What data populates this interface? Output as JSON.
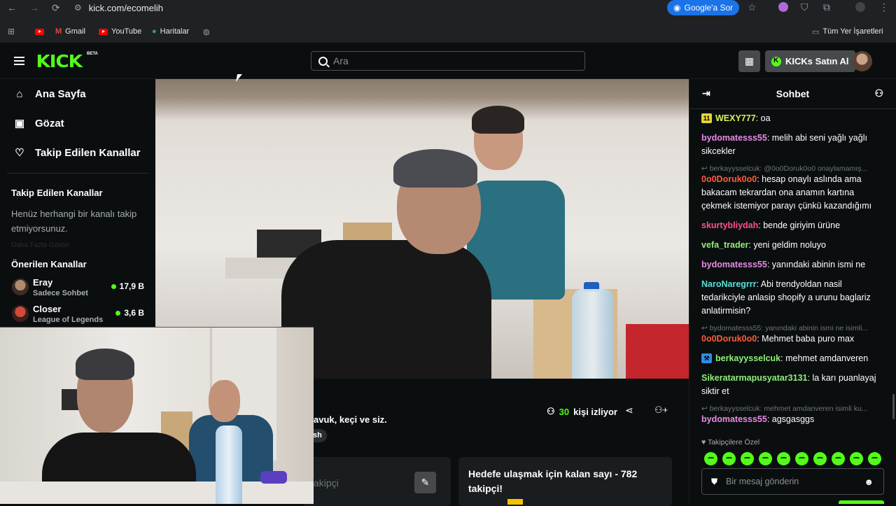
{
  "browser": {
    "url": "kick.com/ecomelih",
    "google_btn": "Google'a Sor",
    "bookmarks": [
      "Gmail",
      "YouTube",
      "Haritalar"
    ],
    "all_bookmarks": "Tüm Yer İşaretleri"
  },
  "header": {
    "logo": "KICK",
    "beta": "BETA",
    "search_placeholder": "Ara",
    "kicks_btn": "KICKs Satın Al"
  },
  "sidebar": {
    "nav": [
      {
        "label": "Ana Sayfa",
        "icon": "home-icon"
      },
      {
        "label": "Gözat",
        "icon": "browse-icon"
      },
      {
        "label": "Takip Edilen Kanallar",
        "icon": "heart-icon"
      }
    ],
    "followed_title": "Takip Edilen Kanallar",
    "followed_empty": "Henüz herhangi bir kanalı takip etmiyorsunuz.",
    "faded_text": "Daha Fazla Göster",
    "recommended_title": "Önerilen Kanallar",
    "channels": [
      {
        "name": "Eray",
        "category": "Sadece Sohbet",
        "viewers": "17,9 B"
      },
      {
        "name": "Closer",
        "category": "League of Legends",
        "viewers": "3,6 B"
      }
    ]
  },
  "stream": {
    "description": "avuk, keçi ve siz.",
    "tag": "sh",
    "viewers_count": "30",
    "viewers_label": "kişi izliyor",
    "goal_placeholder": "akipçi",
    "goal_text": "Hedefe ulaşmak için kalan sayı - 782 takipçi!"
  },
  "chat": {
    "title": "Sohbet",
    "messages": [
      {
        "badge": "11",
        "badge_color": "#e6d33a",
        "user": "WEXY777",
        "color": "#d8f15a",
        "text": "oa"
      },
      {
        "user": "bydomatesss55",
        "color": "#e88ae6",
        "text": "melih abi seni yağlı yağlı sikcekler"
      },
      {
        "reply": "berkayysselcuk: @0o0Doruk0o0 onaylamamış..."
      },
      {
        "user": "0o0Doruk0o0",
        "color": "#ff5a3c",
        "text": "hesap onaylı aslında ama bakacam tekrardan ona anamın kartına çekmek istemiyor parayı çünkü kazandığımı"
      },
      {
        "user": "skurtybliydah",
        "color": "#ff4d8f",
        "text": "bende giriyim ürüne"
      },
      {
        "user": "vefa_trader",
        "color": "#8ef07a",
        "text": "yeni geldim noluyo"
      },
      {
        "user": "bydomatesss55",
        "color": "#e88ae6",
        "text": "yanındaki abinin ismi ne"
      },
      {
        "user": "NaroNaregrrr",
        "color": "#5ae0d8",
        "text": "Abi trendyoldan nasil tedarikciyle anlasip shopify a urunu baglariz anlatirmisin?"
      },
      {
        "reply": "bydomatesss55: yanındaki abinin ismi ne isimli..."
      },
      {
        "user": "0o0Doruk0o0",
        "color": "#ff5a3c",
        "text": "Mehmet baba puro max"
      },
      {
        "badge": "⚒",
        "badge_color": "#2f8de4",
        "user": "berkayysselcuk",
        "color": "#8ef07a",
        "text": "mehmet amdanveren"
      },
      {
        "user": "Sikeratarmapusyatar3131",
        "color": "#8ef07a",
        "text": "la karı puanlayaj siktir et"
      },
      {
        "reply": "berkayysselcuk: mehmet amdanveren isimli ku..."
      },
      {
        "user": "bydomatesss55",
        "color": "#e88ae6",
        "text": "agsgasggs"
      }
    ],
    "followers_only": "Takipçilere Özel",
    "input_placeholder": "Bir mesaj gönderin"
  },
  "colors": {
    "accent": "#53fc18",
    "bg": "#0b0e0f"
  }
}
